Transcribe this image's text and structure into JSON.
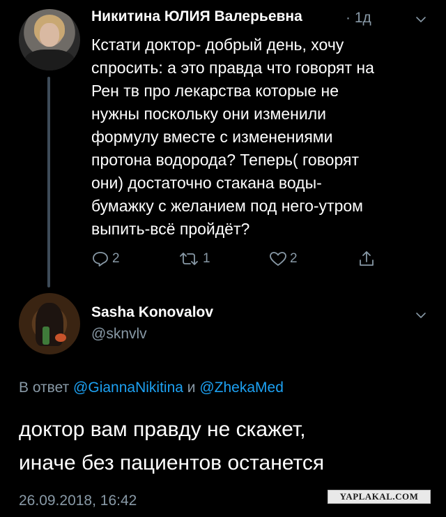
{
  "tweet1": {
    "author_name": "Никитина ЮЛИЯ Валерьевна",
    "time": "· 1д",
    "text_lines": [
      "Кстати доктор- добрый день, хочу",
      "спросить: а это правда что говорят на",
      "Рен тв про лекарства которые не",
      "нужны поскольку они изменили",
      "формулу вместе с изменениями",
      "протона водорода? Теперь( говорят",
      "они) достаточно стакана воды-",
      "бумажку с желанием под него-утром",
      "выпить-всё пройдёт?"
    ],
    "actions": {
      "reply_count": "2",
      "retweet_count": "1",
      "like_count": "2"
    }
  },
  "tweet2": {
    "author_name": "Sasha Konovalov",
    "handle": "@sknvlv",
    "reply_prefix": "В ответ ",
    "reply_to_1": "@GiannaNikitina",
    "reply_and": " и ",
    "reply_to_2": "@ZhekaMed",
    "text_lines": [
      "доктор вам правду не скажет,",
      "иначе без пациентов останется"
    ],
    "date": "26.09.2018, 16:42"
  },
  "watermark": "YAPLAKAL.COM",
  "colors": {
    "background": "#000000",
    "secondary_text": "#8899a6",
    "link": "#1da1f2",
    "thread_line": "#3d4b58"
  },
  "icons": [
    "reply-icon",
    "retweet-icon",
    "like-icon",
    "share-icon",
    "chevron-down-icon"
  ]
}
